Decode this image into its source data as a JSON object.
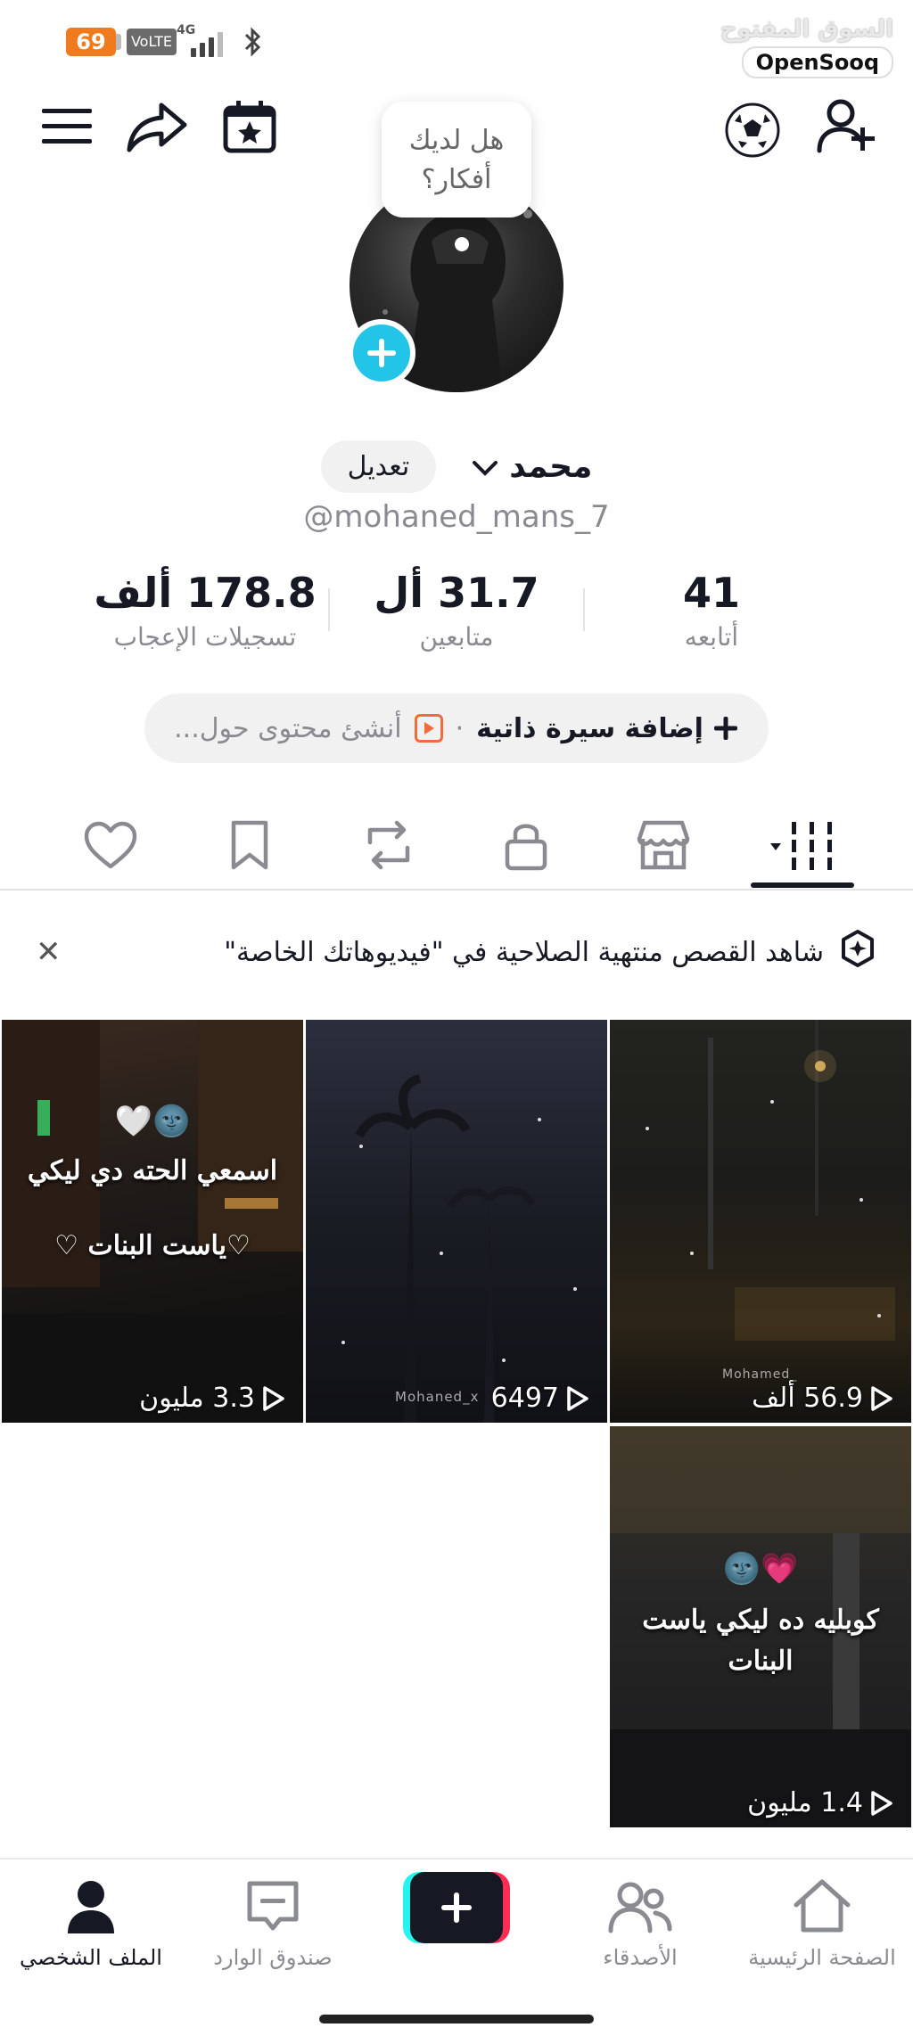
{
  "status_bar": {
    "battery": "69",
    "volte": "VoLTE",
    "network": "4G"
  },
  "watermark": {
    "arabic": "السوق المفتوح",
    "english": "OpenSooq"
  },
  "profile": {
    "bubble_text": "هل لديك أفكار؟",
    "name": "محمد",
    "edit_label": "تعديل",
    "username": "@mohaned_mans_7"
  },
  "stats": {
    "following": {
      "value": "41",
      "label": "أتابعه"
    },
    "followers": {
      "value": "31.7 أل",
      "label": "متابعين"
    },
    "likes": {
      "value": "178.8 ألف",
      "label": "تسجيلات الإعجاب"
    }
  },
  "bio": {
    "add_label": "إضافة سيرة ذاتية",
    "create_label": "أنشئ محتوى حول..."
  },
  "notice": {
    "text": "شاهد القصص منتهية الصلاحية في \"فيديوهاتك الخاصة\""
  },
  "videos": [
    {
      "views": "56.9 ألف",
      "tag": "Mohamed_"
    },
    {
      "views": "6497",
      "tag": "Mohaned_x"
    },
    {
      "views": "3.3 مليون",
      "caption_line1": "اسمعي الحته دي ليكي",
      "caption_line2": "♡ياست البنات ♡",
      "emoji": "🤍🌚"
    },
    {
      "views": "1.4 مليون",
      "caption_line1": "كوبليه ده ليكي ياست",
      "caption_line2": "البنات",
      "emoji": "🌚💗"
    }
  ],
  "bottom_nav": {
    "home": "الصفحة الرئيسية",
    "friends": "الأصدقاء",
    "inbox": "صندوق الوارد",
    "profile": "الملف الشخصي"
  },
  "colors": {
    "accent_cyan": "#25f4ee",
    "accent_red": "#fe2c55",
    "avatar_plus": "#22c5e8",
    "battery": "#f07b1f"
  }
}
